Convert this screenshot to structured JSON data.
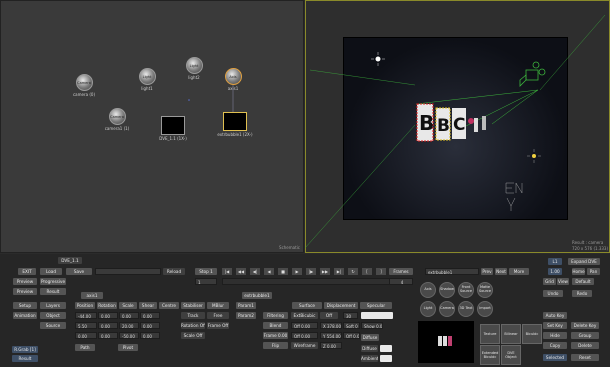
{
  "schematic": {
    "label": "Schematic",
    "nodes": [
      {
        "name": "Camera",
        "label": "camera (0)"
      },
      {
        "name": "Light",
        "label": "light1"
      },
      {
        "name": "Light",
        "label": "light2"
      },
      {
        "name": "Axis",
        "label": "axis1"
      },
      {
        "name": "Camera",
        "label": "camera1 (1)"
      },
      {
        "name": "",
        "label": "DVE_1.1 (1X-)"
      },
      {
        "name": "",
        "label": "extrbubble1 (2X-)"
      }
    ]
  },
  "viewer": {
    "info_line1": "Result : camera",
    "info_line2": "720 x 576 (1.333)",
    "logo_letters": [
      "B",
      "B",
      "C"
    ]
  },
  "tab": {
    "label": "DVE_1.1"
  },
  "left_panel": {
    "exit": "EXIT",
    "load": "Load",
    "save": "Save",
    "reload": "Reload",
    "preview": "Preview",
    "progressive": "Progressive",
    "preview2": "Preview",
    "result": "Result",
    "setup": "Setup",
    "layers": "Layers",
    "animation": "Animation",
    "object": "Object",
    "source": "Source",
    "rgrab": "R.Grab [1]",
    "result2": "Result",
    "stop": "Stop 1",
    "stop_val": "1"
  },
  "axis_panel": {
    "name": "axis1",
    "tabs": [
      "Position",
      "Rotation",
      "Scale",
      "Shear",
      "Centre",
      "Stabiliser",
      "MBlur"
    ],
    "rows": [
      [
        "-44.00",
        "0.00",
        "0.00",
        "0.00"
      ],
      [
        "5.50",
        "0.00",
        "20.00",
        "0.00"
      ],
      [
        "0.00",
        "0.00",
        "-50.00",
        "0.00"
      ]
    ],
    "right_col": [
      "Track",
      "Rotation Off",
      "Scale Off"
    ],
    "right_col2": [
      "Free",
      "Frame Off",
      ""
    ],
    "bottom": [
      "Path",
      "Pivot"
    ]
  },
  "surface_panel": {
    "name": "extrbubble1",
    "tabs": [
      "Param1",
      "Param2",
      "Surface",
      "Displacement",
      "Specular"
    ],
    "left_col": [
      "Filtering",
      "Blend",
      "Frame 0.00",
      "Flip"
    ],
    "col2": [
      "ExtBicubic",
      "Off 0.00",
      "Off 0.00",
      "Wireframe"
    ],
    "col3": [
      "Off",
      "X 378.00",
      "Y 554.00",
      "Z 0.00"
    ],
    "col4": [
      "30",
      "Soft 0",
      "Off 0.00",
      ""
    ],
    "col5": [
      "",
      "Show 0.0",
      "",
      ""
    ],
    "diffuse": "Diffuse",
    "diffuse2": "Diffuse",
    "ambient": "Ambient"
  },
  "timeline": {
    "frames_label": "Frames",
    "frame_value": "4"
  },
  "right_panel": {
    "object_name": "extrbubble1",
    "prev": "Prev",
    "next": "Next",
    "more": "More",
    "circles": [
      "Axis",
      "Shadow",
      "Front Source",
      "Matte Source",
      "Light",
      "Camera",
      "3D Text",
      "Import"
    ],
    "squares": [
      "Texture",
      "Bilinear",
      "Bicubic",
      "Extended Bicubic",
      "DVE Object"
    ]
  },
  "far_right": {
    "layer": "L1",
    "expand": "Expand DVE",
    "zoom": "1.00",
    "home": "Home",
    "pan": "Pan",
    "grid": "Grid",
    "view": "View",
    "default": "Default",
    "undo": "Undo",
    "redo": "Redo",
    "autokey": "Auto Key",
    "set_key": "Set Key",
    "delete_key": "Delete Key",
    "hide": "Hide",
    "group": "Group",
    "copy": "Copy",
    "delete": "Delete",
    "selected": "Selected",
    "reset": "Reset"
  }
}
